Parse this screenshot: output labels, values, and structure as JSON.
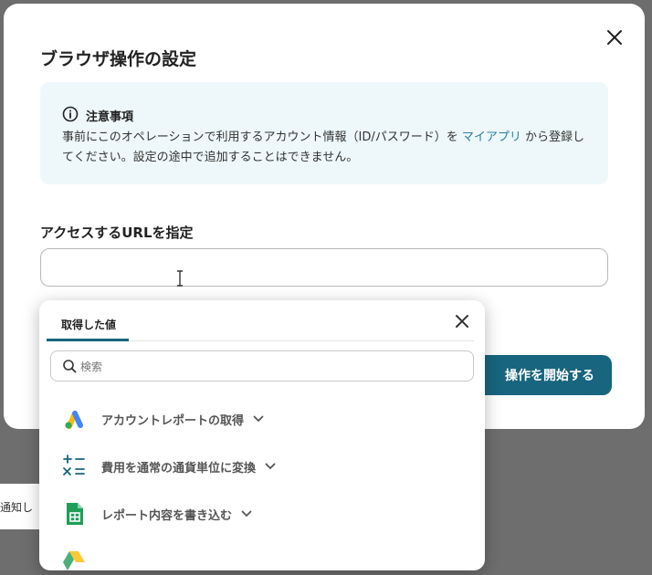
{
  "background": {
    "notify_text": "通知し"
  },
  "modal": {
    "title": "ブラウザ操作の設定",
    "notice": {
      "heading": "注意事項",
      "body_before": "事前にこのオペレーションで利用するアカウント情報（ID/パスワード）を",
      "link": "マイアプリ",
      "body_after": "から登録してください。設定の途中で追加することはできません。"
    },
    "url_label": "アクセスするURLを指定",
    "url_value": "",
    "start_button": "操作を開始する"
  },
  "popup": {
    "tab": "取得した値",
    "search_placeholder": "検索",
    "items": [
      {
        "label": "アカウントレポートの取得",
        "icon": "google-ads-icon"
      },
      {
        "label": "費用を通常の通貨単位に変換",
        "icon": "calculator-icon"
      },
      {
        "label": "レポート内容を書き込む",
        "icon": "google-sheets-icon"
      }
    ]
  }
}
